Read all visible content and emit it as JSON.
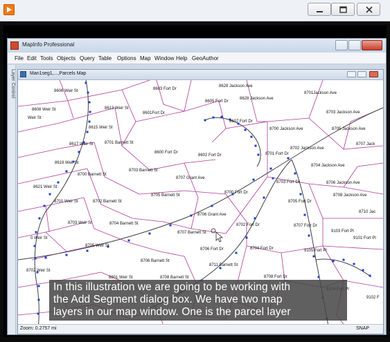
{
  "colors": {
    "parcel_line": "#b1389b",
    "segment_line": "#3f3f3f",
    "segment_node": "#1d3fcf",
    "caption_bg": "#4a4a4a"
  },
  "outer_window": {
    "icon": "play-app-icon",
    "controls": [
      "minimize-icon",
      "maximize-icon",
      "close-icon"
    ]
  },
  "mapinfo": {
    "title": "MapInfo Professional",
    "menus": [
      "File",
      "Edit",
      "Tools",
      "Objects",
      "Query",
      "Table",
      "Options",
      "Map",
      "Window",
      "Help",
      "GeoAuthor"
    ],
    "layer_control_label": "Layer Control",
    "map_window_title": "Man1seg1,...,Parcels Map",
    "status_zoom": "Zoom: 0.2757 mi",
    "status_snap": "SNAP"
  },
  "map_labels": [
    "8606 Weir St",
    "8603 Fort Dr",
    "8628 Jackson Ave",
    "8701Jackson Ave",
    "8605 Fort Dr",
    "8628 Jackson Ave",
    "8608 Weir St",
    "8613 Weir St",
    "8601Fort Dr",
    "8703 Jackson Ave",
    "Weir St",
    "8607 Fort Dr",
    "8700 Jackson Ave",
    "8705 Jackson Ave",
    "8615 Weir St",
    "8701 Barnett St",
    "8707 Jack",
    "8617 Weir St",
    "8702 Jackson Ave",
    "8600 Fort Dr",
    "8602 Fort Dr",
    "8701 Fort Dr",
    "8619 Weir St",
    "8704 Jackson Ave",
    "8703 Barnett St",
    "8700 Barnett St",
    "8707 Grant Ave",
    "8703 Fort Dr",
    "8706 Jackson Ave",
    "8621 Weir St",
    "8700 Fort Dr",
    "8705 Barnett St",
    "8708 Jackson Ave",
    "8701 Weir St",
    "8702 Barnett St",
    "8705 Fort Dr",
    "8706 Grant Ave",
    "8710 Jac",
    "8703 Weir St",
    "8704 Barnett St",
    "8702 Fort Dr",
    "8707 Fort Dr",
    "8707 Barnett St",
    "9103 Fort Pl",
    "9101 Fort Pl",
    "0 Weir St",
    "8705 Weir St",
    "8706 Fort Dr",
    "8704 Fort Dr",
    "9105 Fort Pl",
    "8706 Barnett St",
    "8711 Barnett St",
    "8702 Weir St",
    "8708 Fort Dr",
    "8801 Weir St",
    "8708 Barnett St",
    "9104 Fort Pl",
    "9102 F"
  ],
  "caption_lines": [
    "In this illustration we are going to be working with",
    "the Add Segment dialog box.  We have two map",
    "layers in our map window.  One is the parcel layer"
  ]
}
